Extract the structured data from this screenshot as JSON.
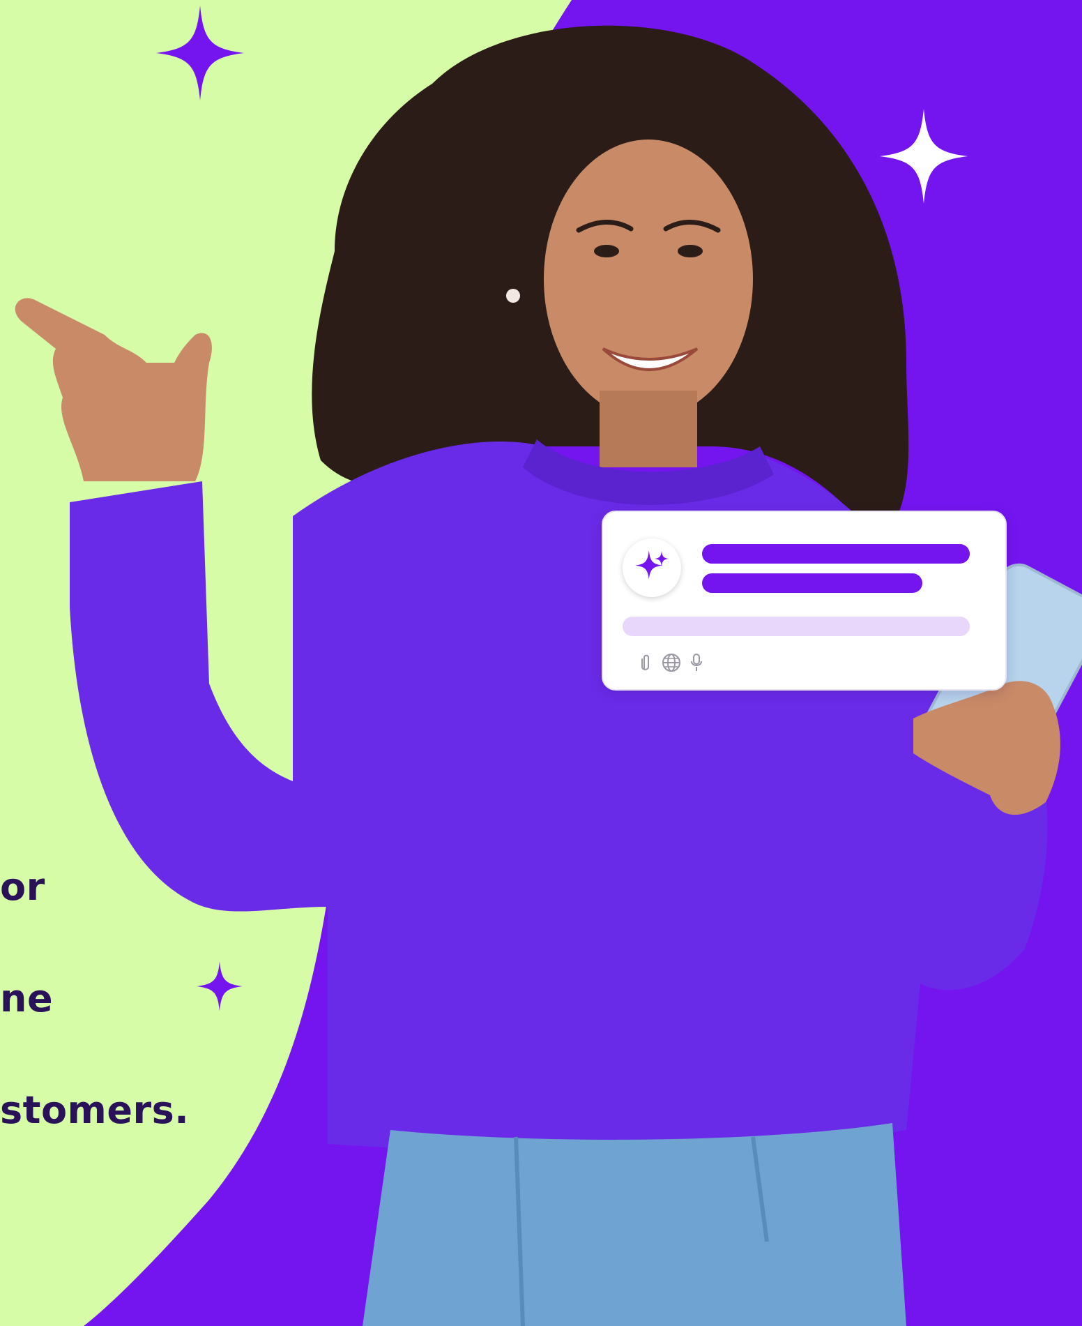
{
  "copy": {
    "line1": "or",
    "line2": "ne",
    "line3": "stomers."
  },
  "colors": {
    "background_purple": "#7415F0",
    "background_green": "#D7FCA8",
    "text_dark": "#2A1259",
    "sweater": "#6A2BE8",
    "card_bar": "#7415F0",
    "card_input": "#E8D6FB"
  },
  "chat_card": {
    "avatar_icon": "sparkle-icon",
    "tool_icons": [
      "paperclip-icon",
      "globe-icon",
      "microphone-icon"
    ]
  },
  "decorations": [
    "sparkle-top",
    "sparkle-right",
    "sparkle-bottom"
  ]
}
